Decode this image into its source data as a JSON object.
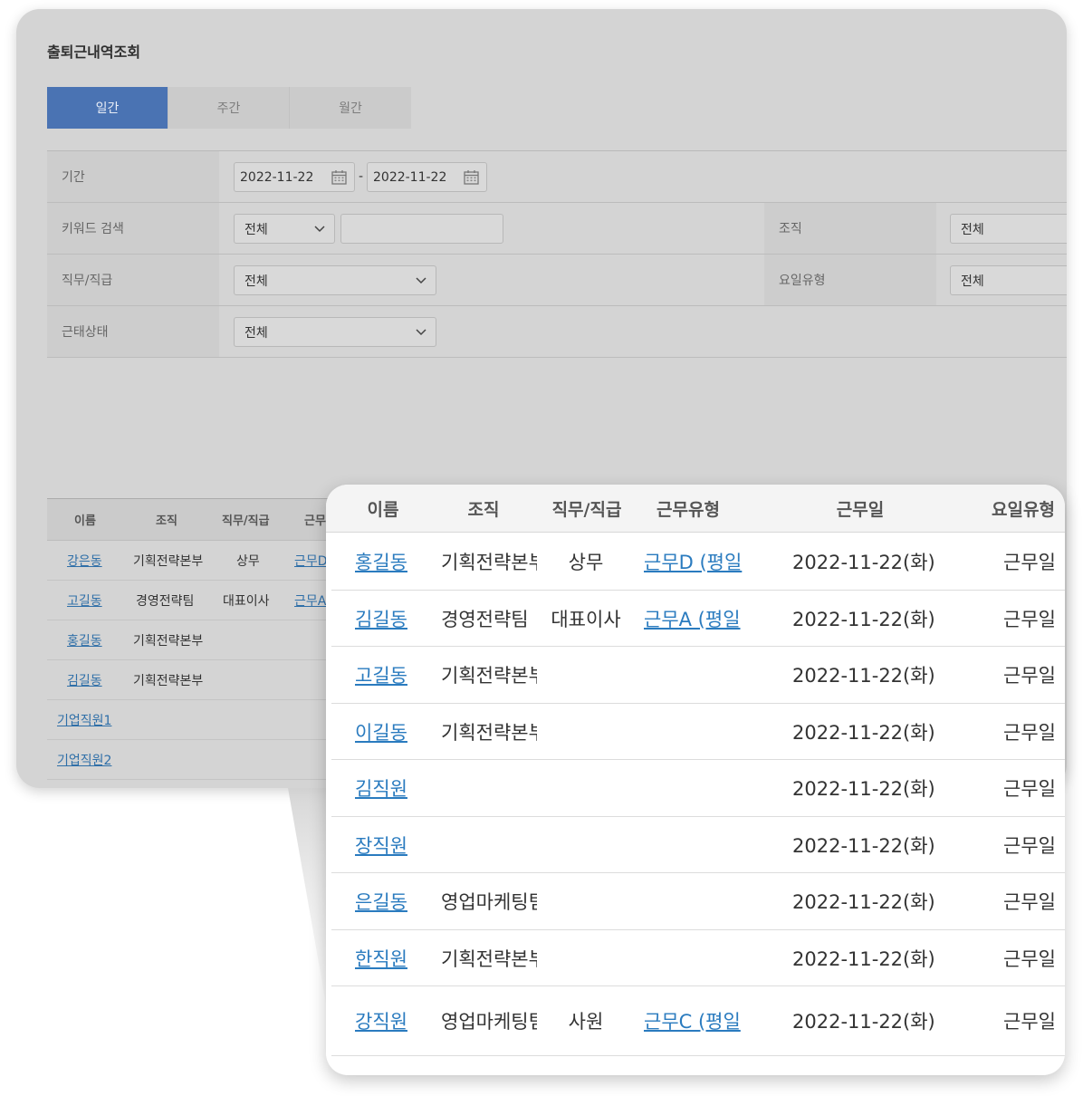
{
  "page_title": "출퇴근내역조회",
  "tabs": [
    "일간",
    "주간",
    "월간"
  ],
  "filters": {
    "period_label": "기간",
    "date_from": "2022-11-22",
    "date_to": "2022-11-22",
    "date_separator": "-",
    "keyword_label": "키워드 검색",
    "keyword_select": "전체",
    "org_label": "조직",
    "org_value": "전체",
    "job_label": "직무/직급",
    "job_value": "전체",
    "daytype_label": "요일유형",
    "daytype_value": "전체",
    "status_label": "근태상태",
    "status_value": "전체"
  },
  "bg_table": {
    "headers": [
      "이름",
      "조직",
      "직무/직급",
      "근무"
    ],
    "rows": [
      {
        "name": "강은동",
        "org": "기획전략본부",
        "job": "상무",
        "type": "근무D"
      },
      {
        "name": "고길동",
        "org": "경영전략팀",
        "job": "대표이사",
        "type": "근무A"
      },
      {
        "name": "홍길동",
        "org": "기획전략본부",
        "job": "",
        "type": ""
      },
      {
        "name": "김길동",
        "org": "기획전략본부",
        "job": "",
        "type": ""
      },
      {
        "name": "기업직원1",
        "org": "",
        "job": "",
        "type": ""
      },
      {
        "name": "기업직원2",
        "org": "",
        "job": "",
        "type": ""
      }
    ]
  },
  "zoom_table": {
    "headers": [
      "이름",
      "조직",
      "직무/직급",
      "근무유형",
      "근무일",
      "요일유형"
    ],
    "rows": [
      {
        "name": "홍길동",
        "org": "기획전략본부",
        "job": "상무",
        "type": "근무D (평일",
        "date": "2022-11-22(화)",
        "daytype": "근무일"
      },
      {
        "name": "김길동",
        "org": "경영전략팀",
        "job": "대표이사",
        "type": "근무A (평일",
        "date": "2022-11-22(화)",
        "daytype": "근무일"
      },
      {
        "name": "고길동",
        "org": "기획전략본부",
        "job": "",
        "type": "",
        "date": "2022-11-22(화)",
        "daytype": "근무일"
      },
      {
        "name": "이길동",
        "org": "기획전략본부",
        "job": "",
        "type": "",
        "date": "2022-11-22(화)",
        "daytype": "근무일"
      },
      {
        "name": "김직원",
        "org": "",
        "job": "",
        "type": "",
        "date": "2022-11-22(화)",
        "daytype": "근무일"
      },
      {
        "name": "장직원",
        "org": "",
        "job": "",
        "type": "",
        "date": "2022-11-22(화)",
        "daytype": "근무일"
      },
      {
        "name": "은길동",
        "org": "영업마케팅팀",
        "job": "",
        "type": "",
        "date": "2022-11-22(화)",
        "daytype": "근무일"
      },
      {
        "name": "한직원",
        "org": "기획전략본부",
        "job": "",
        "type": "",
        "date": "2022-11-22(화)",
        "daytype": "근무일"
      },
      {
        "name": "강직원",
        "org": "영업마케팅팀",
        "job": "사원",
        "type": "근무C (평일",
        "date": "2022-11-22(화)",
        "daytype": "근무일"
      }
    ]
  },
  "colors": {
    "active_tab": "#4a73b3",
    "link": "#2a7bbf"
  }
}
